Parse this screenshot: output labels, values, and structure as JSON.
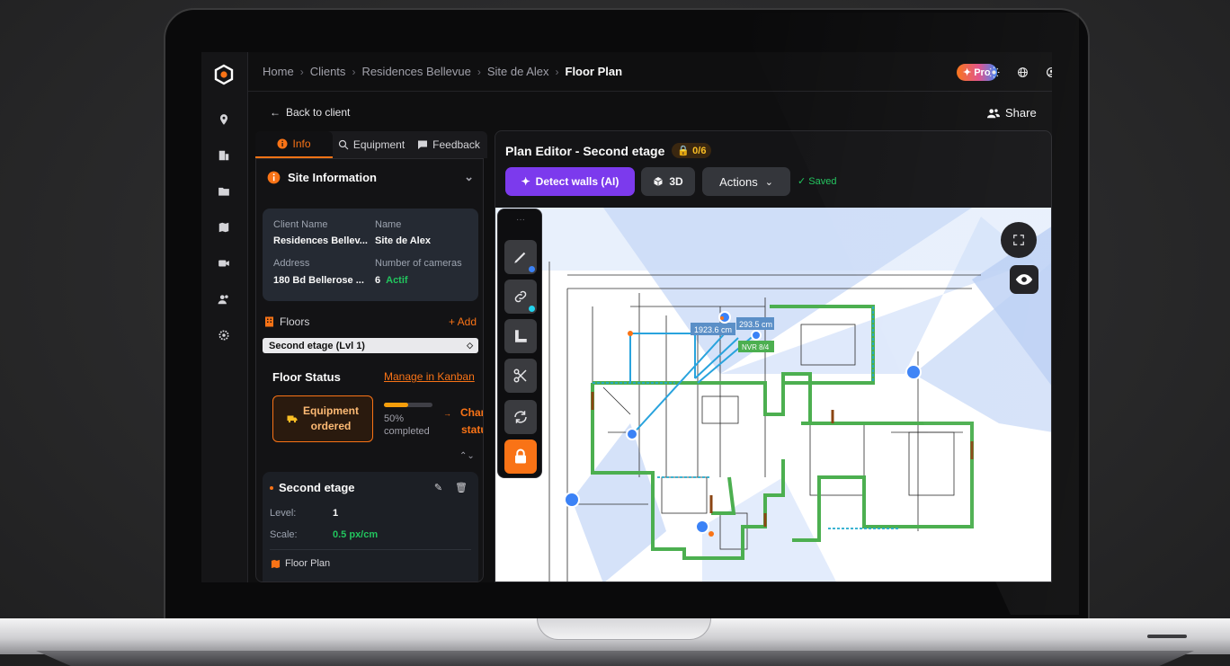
{
  "breadcrumb": [
    "Home",
    "Clients",
    "Residences Bellevue",
    "Site de Alex",
    "Floor Plan"
  ],
  "pro_badge": "Pro",
  "back_label": "Back to client",
  "share_label": "Share",
  "tabs": [
    {
      "label": "Info",
      "icon": "info-icon",
      "active": true
    },
    {
      "label": "Equipment",
      "icon": "search-icon",
      "active": false
    },
    {
      "label": "Feedback",
      "icon": "chat-icon",
      "active": false
    }
  ],
  "site_info": {
    "title": "Site Information",
    "client_name_label": "Client Name",
    "client_name_value": "Residences Bellev...",
    "name_label": "Name",
    "name_value": "Site de Alex",
    "address_label": "Address",
    "address_value": "180 Bd Bellerose ...",
    "cameras_label": "Number of cameras",
    "cameras_value": "6",
    "cameras_status": "Actif"
  },
  "floors": {
    "label": "Floors",
    "add_label": "+ Add",
    "selected": "Second etage (Lvl 1)"
  },
  "floor_status": {
    "title": "Floor Status",
    "kanban_link": "Manage in Kanban",
    "status_line1": "Equipment",
    "status_line2": "ordered",
    "progress": 0.5,
    "pct_label": "50%",
    "completed_label": "completed",
    "change_line1": "Chang",
    "change_line2": "status"
  },
  "floor_card": {
    "title": "Second etage",
    "level_label": "Level:",
    "level_value": "1",
    "scale_label": "Scale:",
    "scale_value": "0.5 px/cm",
    "floor_plan_label": "Floor Plan"
  },
  "editor": {
    "title": "Plan Editor - Second etage",
    "lock_count": "0/6",
    "detect_label": "Detect walls (AI)",
    "btn_3d_label": "3D",
    "actions_label": "Actions",
    "saved_label": "✓ Saved"
  },
  "plan_labels": {
    "measure1": "1923.6 cm",
    "measure2": "293.5 cm",
    "nvr": "NVR 8/4"
  },
  "toolbar": {
    "more": "···",
    "tools": [
      "pencil-icon",
      "link-icon",
      "ruler-icon",
      "scissors-icon",
      "refresh-icon",
      "lock-icon"
    ]
  },
  "colors": {
    "accent": "#f97316",
    "ai_purple": "#7c3aed",
    "saved_green": "#22c55e",
    "wall_green": "#4caf50",
    "camera_blue": "#3b82f6"
  }
}
